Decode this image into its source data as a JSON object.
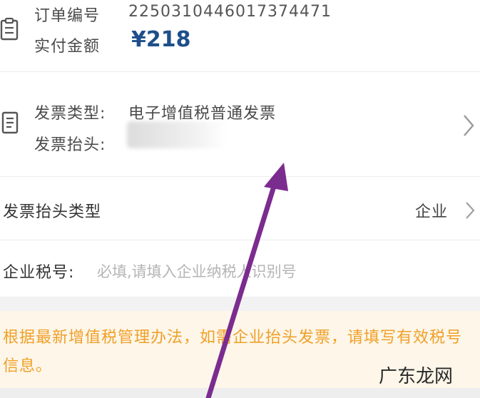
{
  "order": {
    "number_label": "订单编号",
    "number_value": "2250310446017374471",
    "paid_label": "实付金额",
    "paid_value": "¥218"
  },
  "invoice": {
    "type_label": "发票类型:",
    "type_value": "电子增值税普通发票",
    "header_label": "发票抬头:"
  },
  "header_type": {
    "label": "发票抬头类型",
    "value": "企业"
  },
  "tax_id": {
    "label": "企业税号:",
    "placeholder": "必填,请填入企业纳税人识别号"
  },
  "notice": {
    "text": "根据最新增值税管理办法，如需企业抬头发票，请填写有效税号信息。"
  },
  "watermark": "广东龙网",
  "colors": {
    "accent": "#1e4f8a",
    "notice_text": "#f0a028",
    "notice_bg": "#fdf6e9",
    "arrow": "#7b2c8f"
  }
}
